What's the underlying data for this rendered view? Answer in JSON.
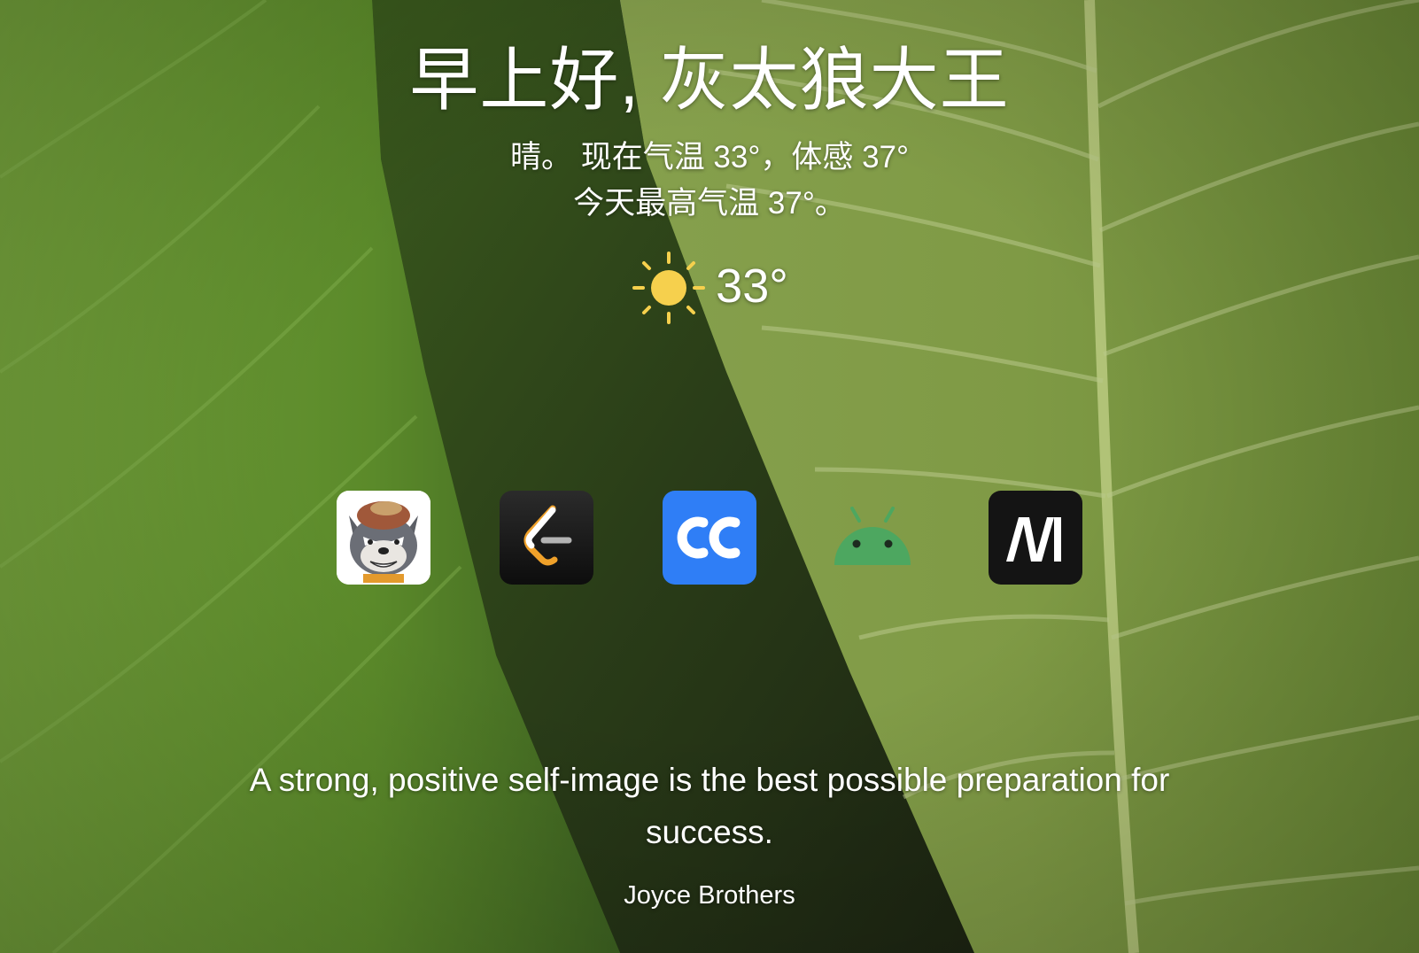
{
  "greeting": "早上好, 灰太狼大王",
  "weather": {
    "description_line1": "晴。 现在气温 33°，体感 37°",
    "description_line2": "今天最高气温 37°。",
    "current_temp": "33°",
    "icon": "sun-icon",
    "icon_color": "#f6d04d"
  },
  "apps": [
    {
      "name": "grey-wolf-app",
      "icon": "wolf-avatar-icon"
    },
    {
      "name": "leetcode-app",
      "icon": "leetcode-icon"
    },
    {
      "name": "cc-app",
      "icon": "cc-icon"
    },
    {
      "name": "android-app",
      "icon": "android-icon"
    },
    {
      "name": "m-app",
      "icon": "m-logo-icon"
    }
  ],
  "quote": {
    "text": "A strong, positive self-image is the best possible preparation for success.",
    "author": "Joyce Brothers"
  },
  "colors": {
    "cc_blue": "#2f7ef6",
    "android_green": "#4da760",
    "leetcode_orange": "#f0a12a"
  }
}
